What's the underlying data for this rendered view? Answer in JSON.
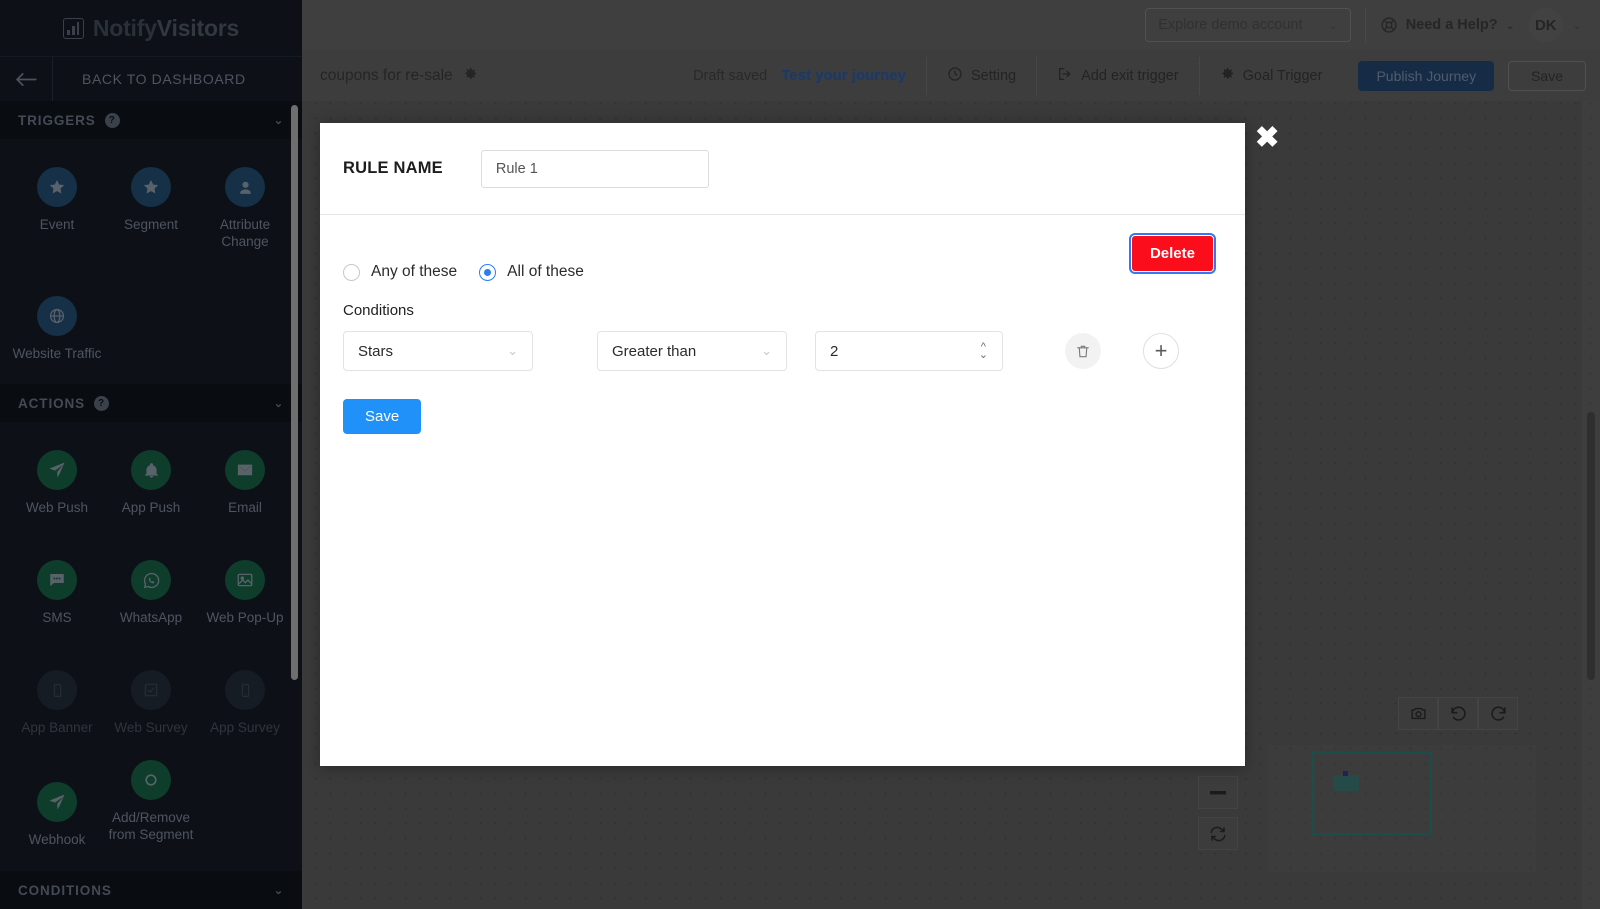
{
  "topbar": {
    "demo_account": "Explore demo account",
    "help": "Need a Help?",
    "avatar_initials": "DK",
    "chevron": "⌄"
  },
  "journeybar": {
    "title": "coupons for re-sale",
    "draft_status": "Draft saved",
    "test_link": "Test your journey",
    "setting": "Setting",
    "add_exit_trigger": "Add exit trigger",
    "goal_trigger": "Goal Trigger",
    "publish": "Publish Journey",
    "save": "Save"
  },
  "sidebar": {
    "logo_primary": "Notify",
    "logo_secondary": "Visitors",
    "back_to_dashboard": "BACK TO DASHBOARD",
    "sections": [
      {
        "name": "TRIGGERS",
        "help_glyph": "?",
        "items": [
          {
            "label": "Event",
            "icon": "star-icon",
            "style": "blue"
          },
          {
            "label": "Segment",
            "icon": "star-icon",
            "style": "blue"
          },
          {
            "label": "Attribute Change",
            "icon": "user-icon",
            "style": "blue"
          },
          {
            "label": "Website Traffic",
            "icon": "globe-icon",
            "style": "blue"
          }
        ]
      },
      {
        "name": "ACTIONS",
        "help_glyph": "?",
        "items": [
          {
            "label": "Web Push",
            "icon": "paper-plane-icon",
            "style": "green"
          },
          {
            "label": "App Push",
            "icon": "bell-icon",
            "style": "green"
          },
          {
            "label": "Email",
            "icon": "envelope-icon",
            "style": "green"
          },
          {
            "label": "SMS",
            "icon": "chat-bubble-icon",
            "style": "green"
          },
          {
            "label": "WhatsApp",
            "icon": "whatsapp-icon",
            "style": "green"
          },
          {
            "label": "Web Pop-Up",
            "icon": "image-icon",
            "style": "green"
          },
          {
            "label": "App Banner",
            "icon": "mobile-icon",
            "style": "dim"
          },
          {
            "label": "Web Survey",
            "icon": "checkbox-icon",
            "style": "dim"
          },
          {
            "label": "App Survey",
            "icon": "mobile-icon",
            "style": "dim"
          },
          {
            "label": "Webhook",
            "icon": "paper-plane-icon",
            "style": "green"
          },
          {
            "label": "Add/Remove from Segment",
            "icon": "circle-icon",
            "style": "green"
          }
        ]
      },
      {
        "name": "CONDITIONS",
        "help_glyph": "",
        "items": []
      }
    ]
  },
  "modal": {
    "rule_name_label": "RULE NAME",
    "rule_name_value": "Rule 1",
    "rule_name_placeholder": "Rule 1",
    "delete_label": "Delete",
    "close_glyph": "✖",
    "match_options": [
      {
        "label": "Any of these",
        "selected": false
      },
      {
        "label": "All of these",
        "selected": true
      }
    ],
    "conditions_label": "Conditions",
    "condition_rows": [
      {
        "attribute": "Stars",
        "operator": "Greater than",
        "value": "2",
        "chevron": "⌄"
      }
    ],
    "save_label": "Save"
  },
  "canvas": {
    "camera_icon": "camera-icon",
    "undo_icon": "undo-icon",
    "redo_icon": "redo-icon",
    "zoom_out_icon": "minus-icon",
    "reset_icon": "refresh-icon"
  },
  "colors": {
    "accent_blue": "#2091f9",
    "danger_red": "#fc0d1b",
    "publish_navy": "#16365e",
    "sidebar_bg": "#0d1117",
    "trigger_icon_bg": "#153047",
    "action_icon_bg": "#0e3d2b",
    "minimap_viewport": "#1f6b66",
    "link_blue": "#1c4b96"
  }
}
